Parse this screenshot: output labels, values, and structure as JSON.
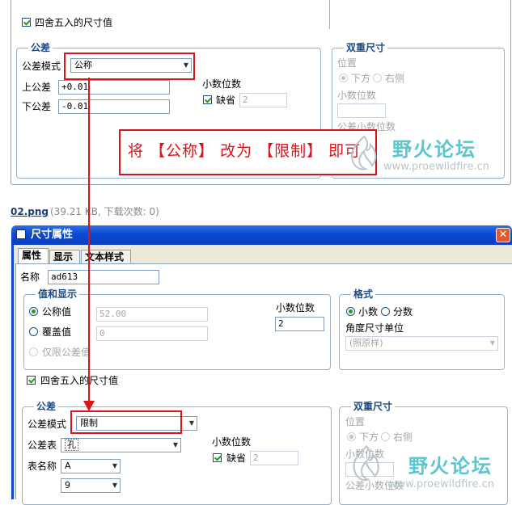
{
  "top_panel": {
    "round_checkbox_label": "四舍五入的尺寸值",
    "tolerance_group_title": "公差",
    "tolerance_mode_label": "公差模式",
    "tolerance_mode_value": "公称",
    "upper_tol_label": "上公差",
    "upper_tol_value": "+0.01",
    "lower_tol_label": "下公差",
    "lower_tol_value": "-0.01",
    "decimal_places_label": "小数位数",
    "default_label": "缺省",
    "decimal_value": "2",
    "dual_group_title": "双重尺寸",
    "position_label": "位置",
    "below_label": "下方",
    "right_label": "右侧",
    "dual_decimal_label": "小数位数",
    "tol_decimal_label": "公差小数位数"
  },
  "annotation": {
    "text": "将 【公称】 改为 【限制】 即可"
  },
  "watermark": {
    "text": "野火论坛",
    "url": "www.proewildfire.cn"
  },
  "file_caption": {
    "name": "02.png",
    "info": "(39.21 KB, 下载次数: 0)"
  },
  "dialog": {
    "title": "尺寸属性",
    "tabs": [
      "属性",
      "显示",
      "文本样式"
    ],
    "name_label": "名称",
    "name_value": "ad613",
    "value_group_title": "值和显示",
    "nominal_label": "公称值",
    "nominal_value": "52.00",
    "override_label": "覆盖值",
    "override_value": "0",
    "tol_only_label": "仅限公差值",
    "decimal_places_label": "小数位数",
    "decimal_value": "2",
    "format_group_title": "格式",
    "decimal_radio": "小数",
    "fraction_radio": "分数",
    "angle_unit_label": "角度尺寸单位",
    "angle_unit_value": "(照原样)",
    "round_checkbox_label": "四舍五入的尺寸值",
    "tolerance_group_title": "公差",
    "tolerance_mode_label": "公差模式",
    "tolerance_mode_value": "限制",
    "tol_table_label": "公差表",
    "tol_table_value": "孔",
    "table_name_label": "表名称",
    "table_name_value": "A",
    "grade_value": "9",
    "decimal_places_label2": "小数位数",
    "default_label": "缺省",
    "decimal_value2": "2",
    "dual_group_title": "双重尺寸",
    "position_label": "位置",
    "below_label": "下方",
    "right_label": "右侧",
    "dual_decimal_label": "小数位数",
    "tol_decimal_label": "公差小数位数"
  },
  "colors": {
    "annotation_red": "#d9141b",
    "titlebar_blue": "#0a4ad2",
    "checkmark_green": "#21a121",
    "watermark_teal": "#33b8c6"
  }
}
